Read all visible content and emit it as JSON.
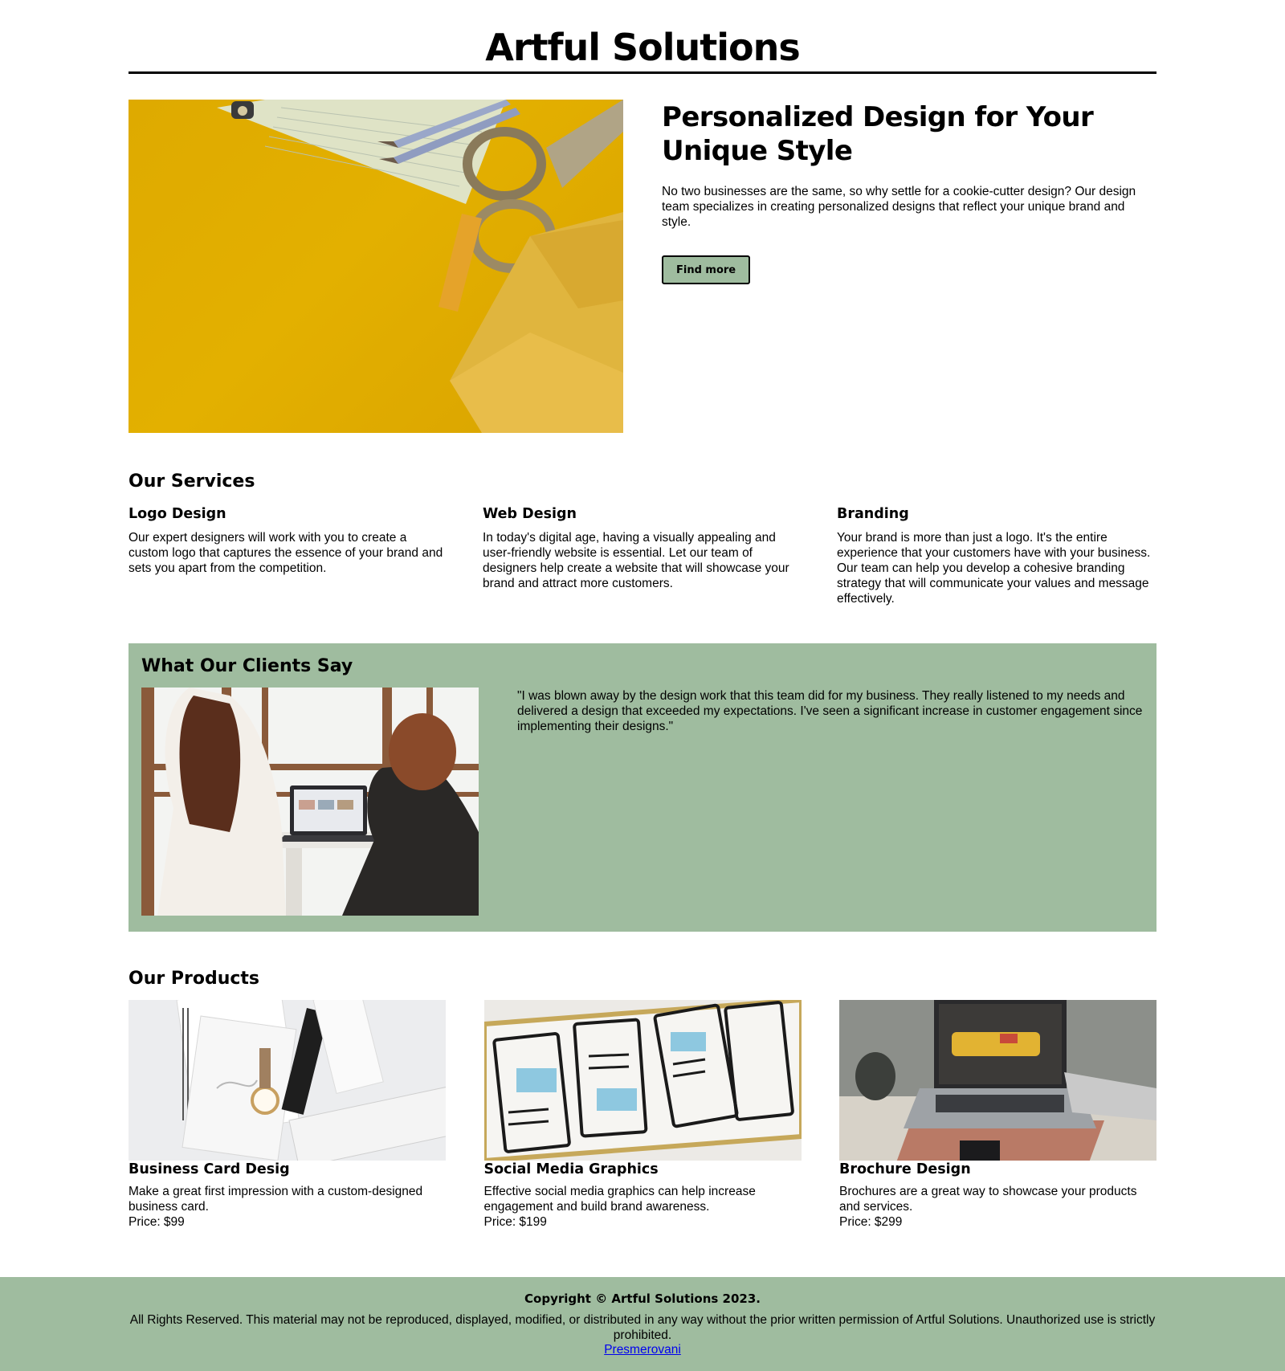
{
  "site": {
    "title": "Artful Solutions"
  },
  "hero": {
    "heading": "Personalized Design for Your Unique Style",
    "body": "No two businesses are the same, so why settle for a cookie-cutter design? Our design team specializes in creating personalized designs that reflect your unique brand and style.",
    "button_label": "Find more",
    "image_icon": "desk-supplies-photo"
  },
  "services": {
    "title": "Our Services",
    "items": [
      {
        "name": "Logo Design",
        "description": "Our expert designers will work with you to create a custom logo that captures the essence of your brand and sets you apart from the competition."
      },
      {
        "name": "Web Design",
        "description": "In today's digital age, having a visually appealing and user-friendly website is essential. Let our team of designers help create a website that will showcase your brand and attract more customers."
      },
      {
        "name": "Branding",
        "description": "Your brand is more than just a logo. It's the entire experience that your customers have with your business. Our team can help you develop a cohesive branding strategy that will communicate your values and message effectively."
      }
    ]
  },
  "clients": {
    "title": "What Our Clients Say",
    "quote": "\"I was blown away by the design work that this team did for my business. They really listened to my needs and delivered a design that exceeded my expectations. I've seen a significant increase in customer engagement since implementing their designs.\""
  },
  "products": {
    "title": "Our Products",
    "items": [
      {
        "name": "Business Card Desig",
        "description": "Make a great first impression with a custom-designed business card.",
        "price": "Price: $99"
      },
      {
        "name": "Social Media Graphics",
        "description": "Effective social media graphics can help increase engagement and build brand awareness.",
        "price": "Price: $199"
      },
      {
        "name": "Brochure Design",
        "description": "Brochures are a great way to showcase your products and services.",
        "price": "Price: $299"
      }
    ]
  },
  "footer": {
    "copyright": "Copyright © Artful Solutions 2023.",
    "rights": "All Rights Reserved. This material may not be reproduced, displayed, modified, or distributed in any way without the prior written permission of Artful Solutions. Unauthorized use is strictly prohibited.",
    "link": "Presmerovani"
  },
  "colors": {
    "accent_green": "#9fbc9f",
    "hero_yellow": "#e0ab00",
    "link_blue": "#0000ee"
  }
}
